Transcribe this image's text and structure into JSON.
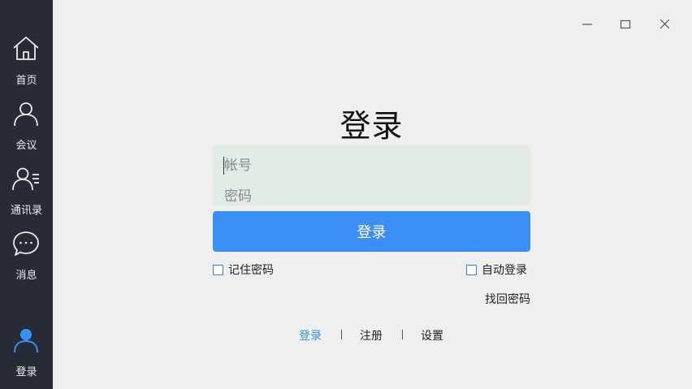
{
  "sidebar": {
    "items": [
      {
        "label": "首页",
        "icon": "home-icon"
      },
      {
        "label": "会议",
        "icon": "user-icon"
      },
      {
        "label": "通讯录",
        "icon": "contacts-icon"
      },
      {
        "label": "消息",
        "icon": "chat-icon"
      },
      {
        "label": "登录",
        "icon": "user-filled-icon"
      }
    ]
  },
  "window_controls": {
    "minimize": "minimize-icon",
    "maximize": "maximize-icon",
    "close": "close-icon"
  },
  "login": {
    "title": "登录",
    "account_placeholder": "帐号",
    "account_value": "",
    "password_placeholder": "密码",
    "password_value": "",
    "submit_label": "登录",
    "remember_password_label": "记住密码",
    "auto_login_label": "自动登录",
    "forgot_password_label": "找回密码"
  },
  "bottom_tabs": [
    {
      "label": "登录",
      "active": true
    },
    {
      "label": "注册",
      "active": false
    },
    {
      "label": "设置",
      "active": false
    }
  ],
  "colors": {
    "sidebar_bg": "#262b35",
    "accent": "#3a8ef5",
    "form_bg": "#e0ece4",
    "page_bg": "#efefef"
  }
}
